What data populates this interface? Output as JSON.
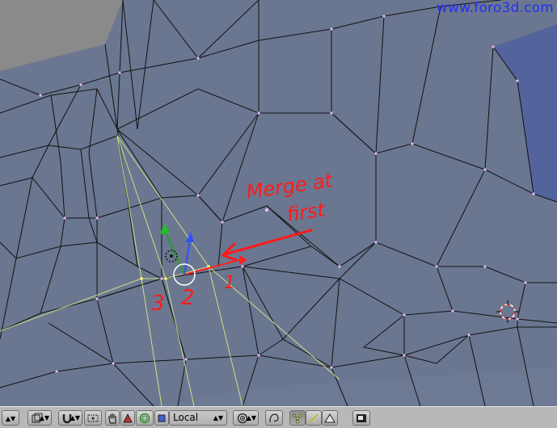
{
  "watermark": "www.foro3d.com",
  "annotations": {
    "merge_note_line1": "Merge at",
    "merge_note_line2": "first",
    "vertex_label_1": "1",
    "vertex_label_2": "2",
    "vertex_label_3": "3"
  },
  "colors": {
    "viewport_bg": "#6b7790",
    "annotation": "#ff1a1a",
    "watermark": "#2430f0",
    "selected_face": "#4a5a9c",
    "toolbar_bg": "#b8b8b8"
  },
  "toolbar": {
    "orientation_value": "Local",
    "icons": [
      "arrow-updown-icon",
      "viewport-shading-icon",
      "magnet-icon",
      "snap-icon",
      "hand-icon",
      "rotate-icon",
      "scale-icon",
      "local-box-icon",
      "pivot-icon",
      "proportional-icon",
      "vertex-select-icon",
      "edge-select-icon",
      "face-select-icon",
      "occlude-icon"
    ]
  }
}
